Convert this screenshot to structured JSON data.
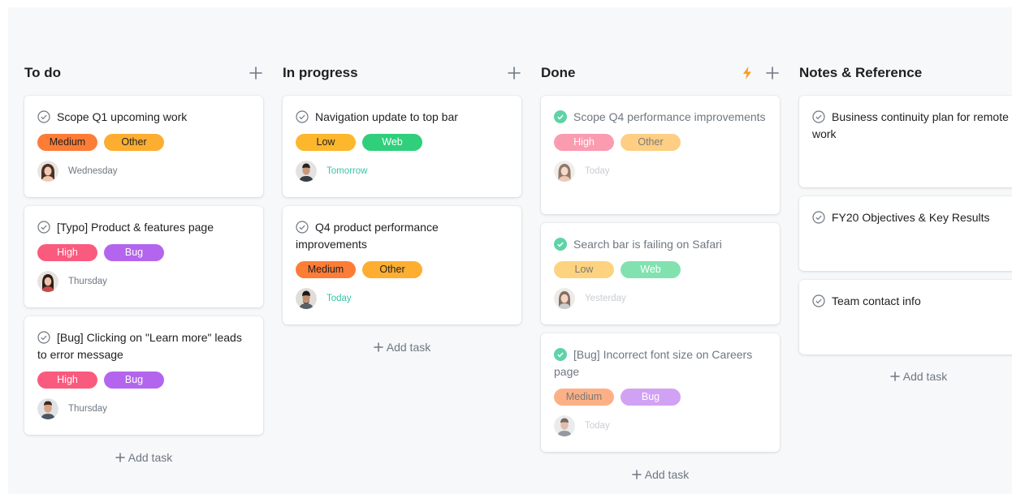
{
  "colors": {
    "Medium": "#fd7c36",
    "Other": "#fdae31",
    "High": "#fa5a7d",
    "Bug": "#b465ee",
    "Low": "#fdb72c",
    "Web": "#2fcf7c",
    "check_done": "#5fd3a8",
    "check_open": "#6f7782"
  },
  "columns": [
    {
      "title": "To do",
      "add_task_label": "Add task",
      "cards": [
        {
          "title": "Scope Q1 upcoming work",
          "tags": [
            "Medium",
            "Other"
          ],
          "due": "Wednesday",
          "avatar": "woman-1"
        },
        {
          "title": "[Typo] Product & features page",
          "tags": [
            "High",
            "Bug"
          ],
          "due": "Thursday",
          "avatar": "woman-2"
        },
        {
          "title": "[Bug] Clicking on \"Learn more\" leads to error message",
          "tags": [
            "High",
            "Bug"
          ],
          "due": "Thursday",
          "avatar": "man-1"
        }
      ]
    },
    {
      "title": "In progress",
      "add_task_label": "Add task",
      "cards": [
        {
          "title": "Navigation update to top bar",
          "tags": [
            "Low",
            "Web"
          ],
          "due": "Tomorrow",
          "avatar": "man-2"
        },
        {
          "title": "Q4 product performance improvements",
          "tags": [
            "Medium",
            "Other"
          ],
          "due": "Today",
          "avatar": "man-3"
        }
      ]
    },
    {
      "title": "Done",
      "add_task_label": "Add task",
      "cards": [
        {
          "title": "Scope Q4 performance improvements",
          "tags": [
            "High",
            "Other"
          ],
          "due": "Today",
          "avatar": "woman-3"
        },
        {
          "title": "Search bar is failing on Safari",
          "tags": [
            "Low",
            "Web"
          ],
          "due": "Yesterday",
          "avatar": "woman-4"
        },
        {
          "title": "[Bug] Incorrect font size on Careers page",
          "tags": [
            "Medium",
            "Bug"
          ],
          "due": "Today",
          "avatar": "man-4"
        }
      ]
    },
    {
      "title": "Notes & Reference",
      "add_task_label": "Add task",
      "cards": [
        {
          "title": "Business continuity plan for remote work"
        },
        {
          "title": "FY20 Objectives & Key Results"
        },
        {
          "title": "Team contact info"
        }
      ]
    }
  ]
}
